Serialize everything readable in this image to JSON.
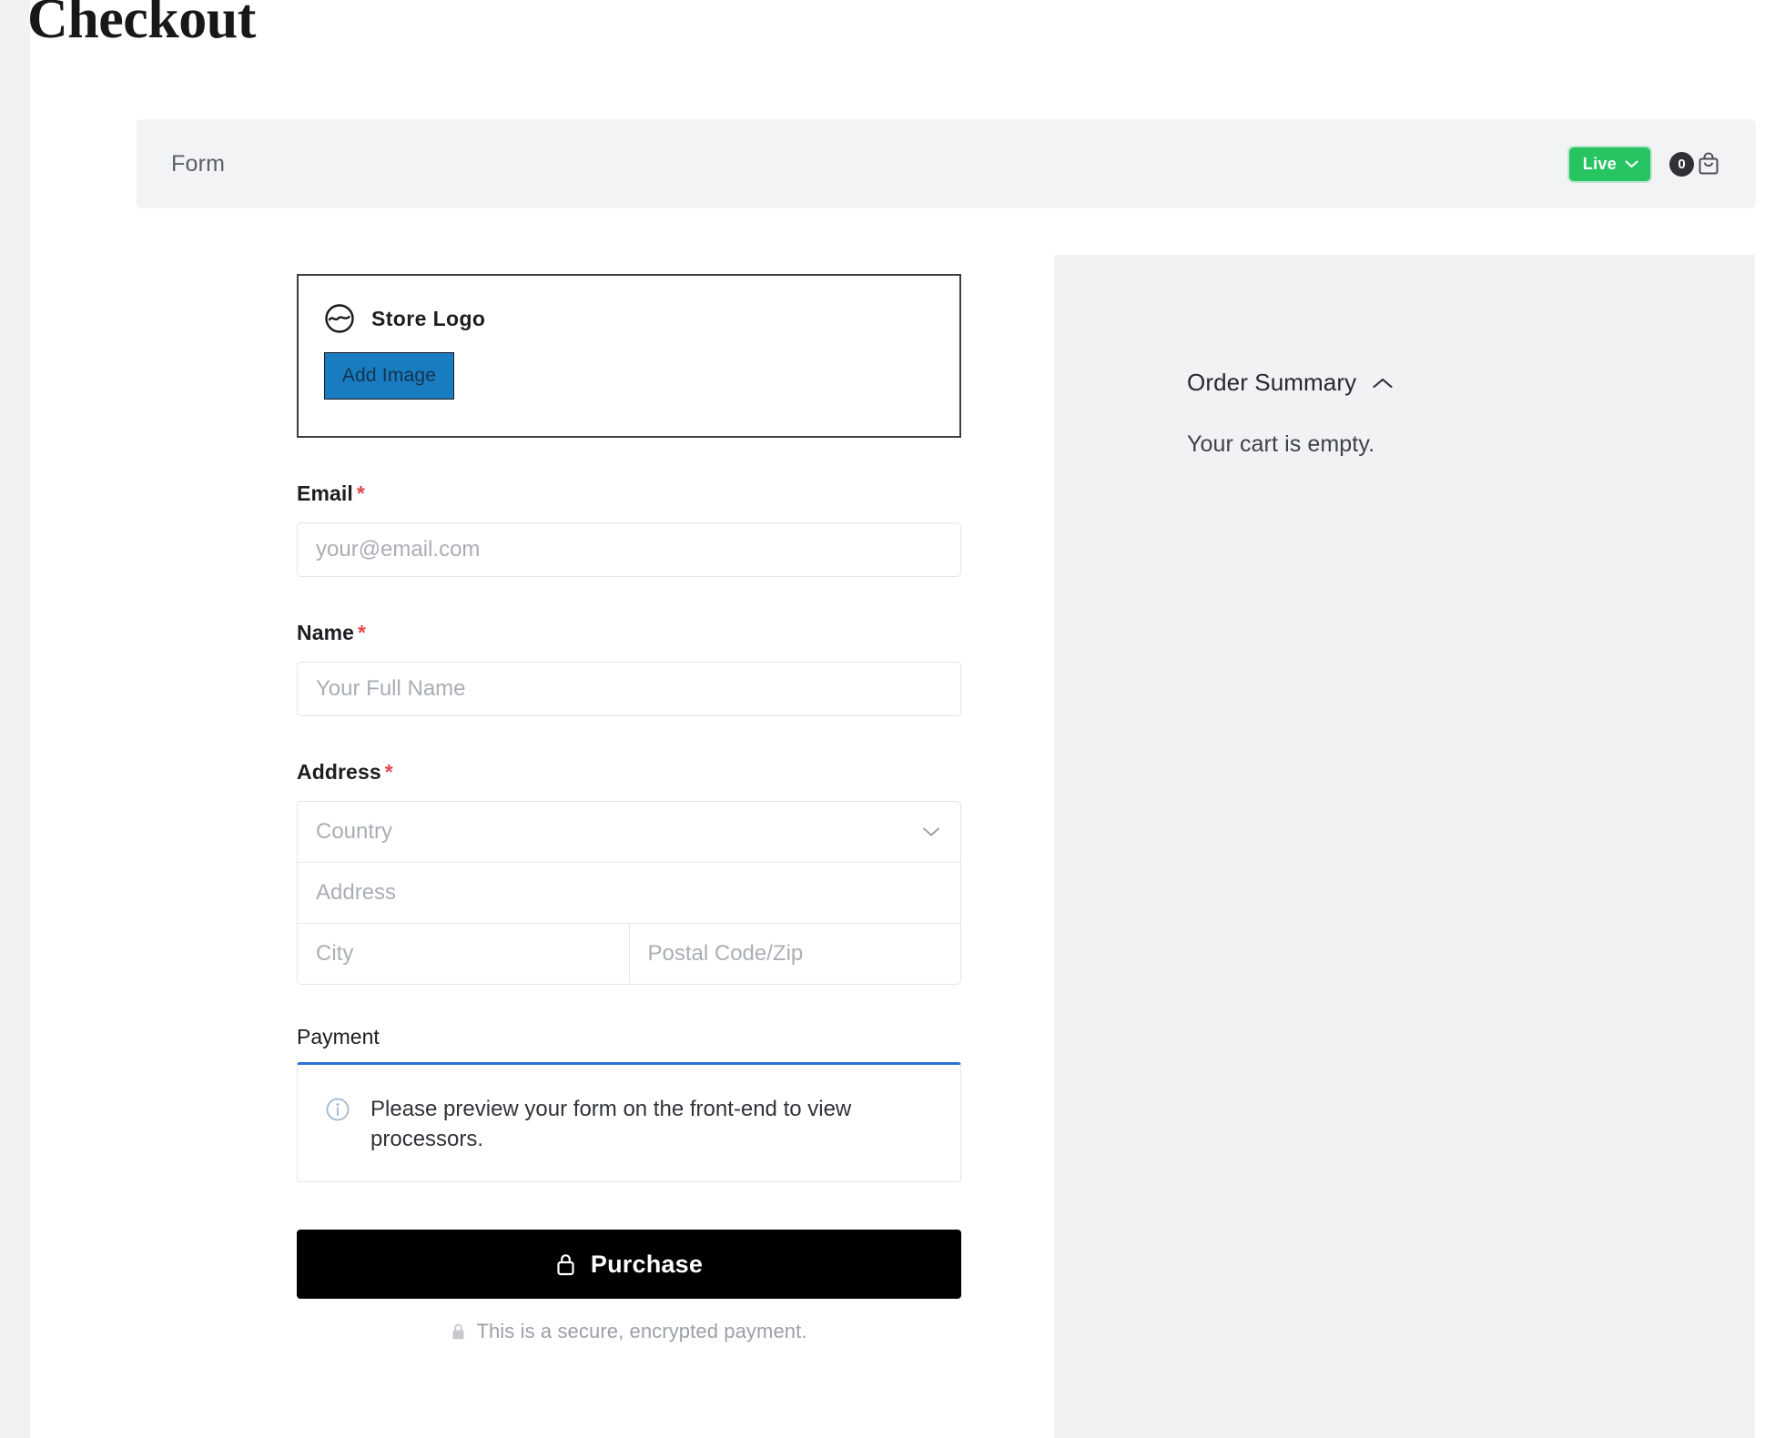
{
  "page": {
    "title": "Checkout"
  },
  "toolbar": {
    "title": "Form",
    "live_label": "Live",
    "cart_count": "0",
    "icons": {
      "chevron": "chevron-down-icon",
      "cart": "shopping-bag-icon"
    }
  },
  "logo_card": {
    "label": "Store Logo",
    "add_image_label": "Add Image",
    "icon": "store-logo-icon"
  },
  "fields": {
    "email": {
      "label": "Email",
      "required_mark": "*",
      "value": "",
      "placeholder": "your@email.com"
    },
    "name": {
      "label": "Name",
      "required_mark": "*",
      "value": "",
      "placeholder": "Your Full Name"
    },
    "address": {
      "label": "Address",
      "required_mark": "*",
      "country": {
        "value": "",
        "placeholder": "Country"
      },
      "street": {
        "value": "",
        "placeholder": "Address"
      },
      "city": {
        "value": "",
        "placeholder": "City"
      },
      "postal": {
        "value": "",
        "placeholder": "Postal Code/Zip"
      }
    }
  },
  "payment": {
    "label": "Payment",
    "notice": "Please preview your form on the front-end to view processors.",
    "icon": "info-circle-icon"
  },
  "purchase": {
    "label": "Purchase",
    "icon": "lock-icon",
    "secure_note": "This is a secure, encrypted payment.",
    "secure_icon": "lock-icon"
  },
  "summary": {
    "title": "Order Summary",
    "collapse_icon": "chevron-up-icon",
    "empty_text": "Your cart is empty."
  },
  "colors": {
    "accent_green": "#27c462",
    "accent_blue": "#1a7cc0",
    "payment_border": "#2b6fd4",
    "required_red": "#e2464a",
    "purchase_bg": "#000000",
    "panel_bg": "#f1f2f4"
  }
}
